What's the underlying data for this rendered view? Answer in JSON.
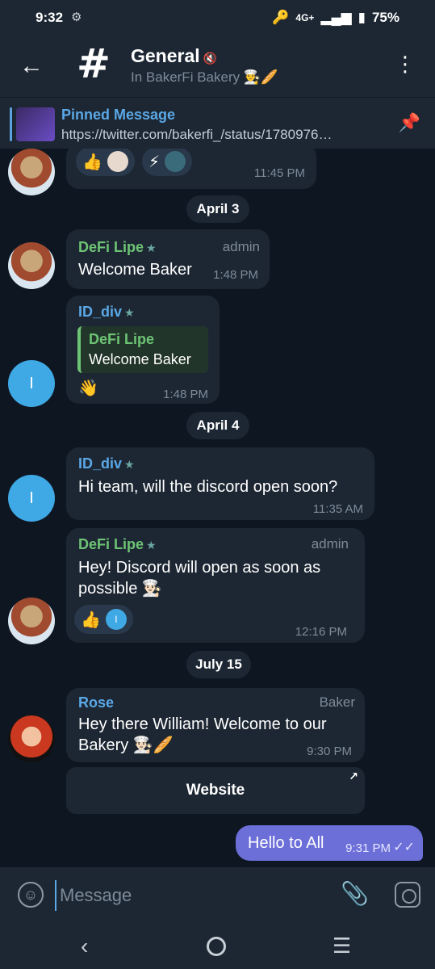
{
  "status_bar": {
    "time": "9:32",
    "network": "4G+",
    "battery": "75%"
  },
  "header": {
    "title": "General",
    "subtitle": "In BakerFi Bakery 👨‍🍳🥖",
    "back_icon": "arrow-left-icon",
    "menu_icon": "kebab-menu-icon"
  },
  "pinned": {
    "label": "Pinned Message",
    "text": "https://twitter.com/bakerfi_/status/1780976…"
  },
  "messages": {
    "m1": {
      "reaction1": "👍",
      "reaction2": "⚡",
      "time": "11:45 PM"
    },
    "date1": "April 3",
    "m2": {
      "sender": "DeFi Lipe",
      "role": "admin",
      "text": "Welcome Baker",
      "time": "1:48 PM"
    },
    "m3": {
      "sender": "ID_div",
      "quote_sender": "DeFi Lipe",
      "quote_text": "Welcome Baker",
      "text": "👋",
      "time": "1:48 PM",
      "avatar_letter": "I"
    },
    "date2": "April 4",
    "m4": {
      "sender": "ID_div",
      "text": "Hi team, will the discord open soon?",
      "time": "11:35 AM",
      "avatar_letter": "I"
    },
    "m5": {
      "sender": "DeFi Lipe",
      "role": "admin",
      "text_line1": "Hey! Discord will open as soon as",
      "text_line2": "possible 👨🏻‍🍳",
      "reaction": "👍",
      "reaction_avatar_letter": "I",
      "time": "12:16 PM"
    },
    "date3": "July 15",
    "m6": {
      "sender": "Rose",
      "role": "Baker",
      "text_line1": "Hey there William! Welcome to our",
      "text_line2": "Bakery 👨🏻‍🍳🥖",
      "time": "9:30 PM",
      "button": "Website"
    },
    "own": {
      "text": "Hello to All",
      "time": "9:31 PM"
    }
  },
  "input": {
    "placeholder": "Message"
  }
}
